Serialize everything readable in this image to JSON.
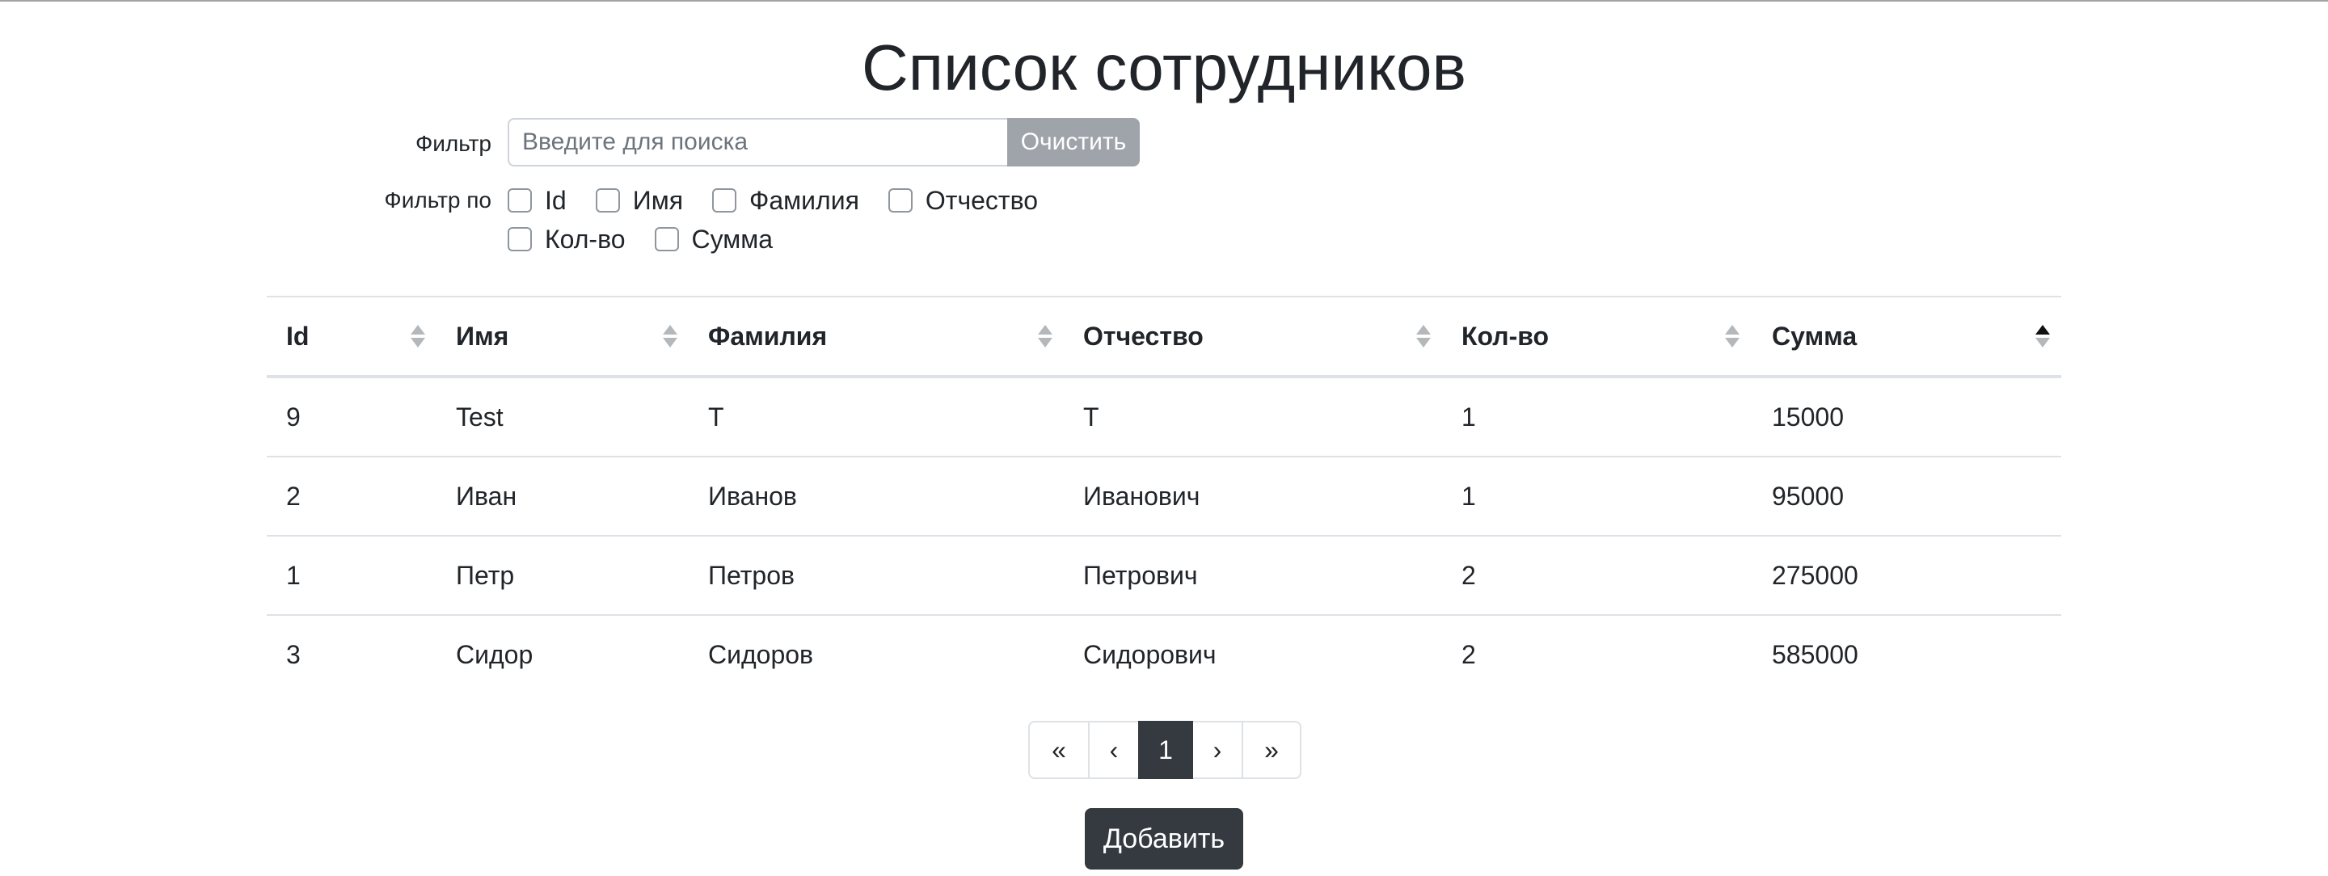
{
  "page": {
    "title": "Список сотрудников"
  },
  "filter": {
    "label": "Фильтр",
    "input_value": "",
    "placeholder": "Введите для поиска",
    "clear_label": "Очистить",
    "by_label": "Фильтр по",
    "fields": [
      {
        "label": "Id",
        "checked": false
      },
      {
        "label": "Имя",
        "checked": false
      },
      {
        "label": "Фамилия",
        "checked": false
      },
      {
        "label": "Отчество",
        "checked": false
      },
      {
        "label": "Кол-во",
        "checked": false
      },
      {
        "label": "Сумма",
        "checked": false
      }
    ]
  },
  "table": {
    "columns": [
      "Id",
      "Имя",
      "Фамилия",
      "Отчество",
      "Кол-во",
      "Сумма"
    ],
    "sorted_column": "Сумма",
    "sort_direction": "ascending",
    "rows": [
      [
        "9",
        "Test",
        "Т",
        "Т",
        "1",
        "15000"
      ],
      [
        "2",
        "Иван",
        "Иванов",
        "Иванович",
        "1",
        "95000"
      ],
      [
        "1",
        "Петр",
        "Петров",
        "Петрович",
        "2",
        "275000"
      ],
      [
        "3",
        "Сидор",
        "Сидоров",
        "Сидорович",
        "2",
        "585000"
      ]
    ]
  },
  "pagination": {
    "first": "«",
    "prev": "‹",
    "current": "1",
    "next": "›",
    "last": "»"
  },
  "actions": {
    "add_label": "Добавить"
  },
  "colors": {
    "dark_button": "#343a40",
    "clear_button": "#9ea4aa",
    "border": "#dee2e6",
    "text": "#212529"
  }
}
